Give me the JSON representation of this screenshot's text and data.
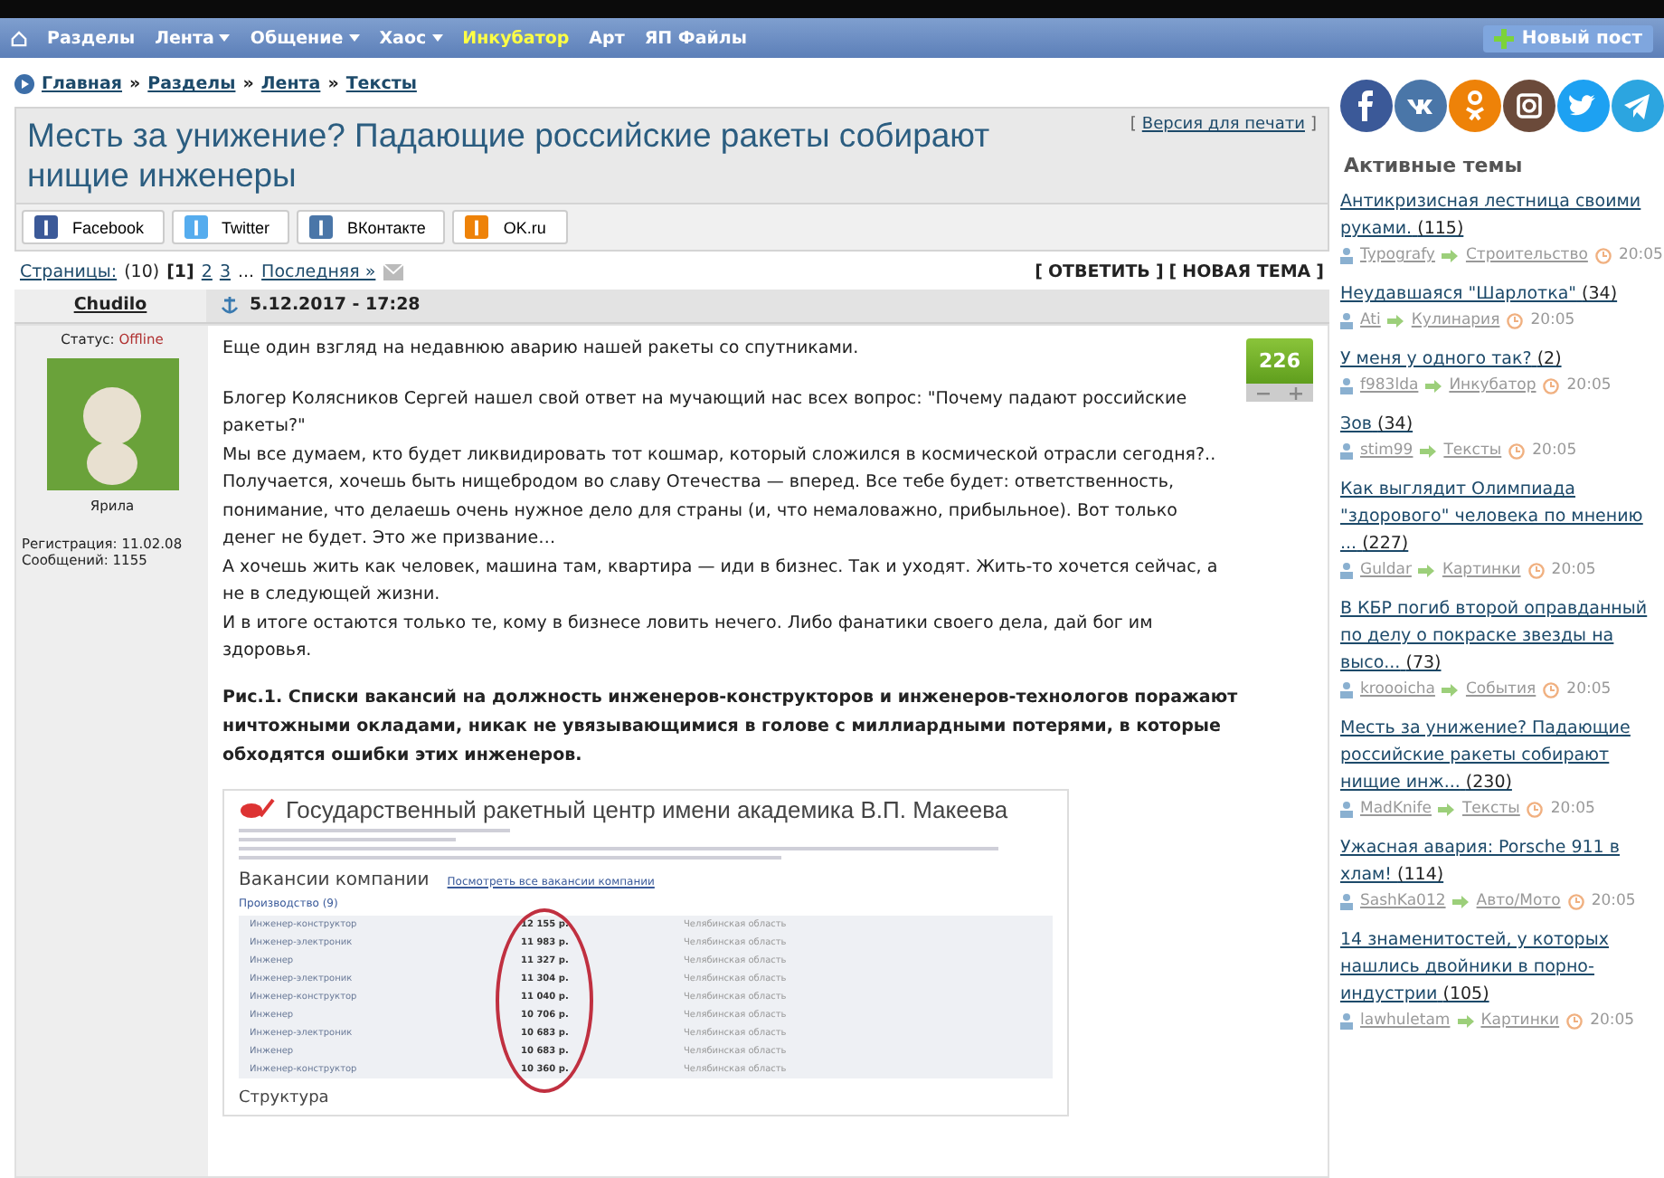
{
  "nav": {
    "items": [
      {
        "label": "Разделы",
        "dropdown": false,
        "selected": false
      },
      {
        "label": "Лента",
        "dropdown": true,
        "selected": false
      },
      {
        "label": "Общение",
        "dropdown": true,
        "selected": false
      },
      {
        "label": "Хаос",
        "dropdown": true,
        "selected": false
      },
      {
        "label": "Инкубатор",
        "dropdown": false,
        "selected": true
      },
      {
        "label": "Арт",
        "dropdown": false,
        "selected": false
      },
      {
        "label": "ЯП Файлы",
        "dropdown": false,
        "selected": false
      }
    ],
    "new_post": "Новый пост"
  },
  "breadcrumbs": [
    {
      "label": "Главная"
    },
    {
      "separator": "»",
      "label": "Разделы"
    },
    {
      "separator": "»",
      "label": "Лента"
    },
    {
      "separator": "»",
      "label": "Тексты"
    }
  ],
  "topic": {
    "title": "Месть за унижение? Падающие российские ракеты собирают нищие инженеры",
    "print_link": {
      "open": "[",
      "label": "Версия для печати",
      "close": "]"
    }
  },
  "share": [
    {
      "kind": "facebook",
      "label": "Facebook"
    },
    {
      "kind": "twitter",
      "label": "Twitter"
    },
    {
      "kind": "vk",
      "label": "ВКонтакте"
    },
    {
      "kind": "ok",
      "label": "OK.ru"
    }
  ],
  "pager": {
    "label": "Страницы:",
    "count": "(10)",
    "pages": [
      {
        "label": "[1]",
        "selected": true
      },
      {
        "label": "2",
        "selected": false
      },
      {
        "label": "3",
        "selected": false
      }
    ],
    "ellipsis": "...",
    "last": "Последняя »"
  },
  "actions": [
    {
      "open": "[",
      "label": "ОТВЕТИТЬ",
      "close": "]"
    },
    {
      "open": "[",
      "label": "НОВАЯ ТЕМА",
      "close": "]"
    }
  ],
  "post": {
    "author": "Chudilo",
    "date": "5.12.2017 - 17:28",
    "status_label": "Статус:",
    "status": "Offline",
    "online": false,
    "rank": "Ярила",
    "registered": "Регистрация: 11.02.08",
    "messages": "Сообщений: 1155",
    "rating": "226",
    "paragraphs": [
      "Еще один взгляд на недавнюю аварию нашей ракеты со спутниками.",
      "Блогер Колясников Сергей нашел свой ответ на мучающий нас всех вопрос: \"Почему падают российские ракеты?\"",
      "Мы все думаем, кто будет ликвидировать тот кошмар, который сложился в космической отрасли сегодня?..",
      "Получается, хочешь быть нищебродом во славу Отечества — вперед. Все тебе будет: ответственность, понимание, что делаешь очень нужное дело для страны (и, что немаловажно, прибыльное). Вот только денег не будет. Это же призвание…",
      "А хочешь жить как человек, машина там, квартира — иди в бизнес. Так и уходят. Жить-то хочется сейчас, а не в следующей жизни.",
      "И в итоге остаются только те, кому в бизнесе ловить нечего. Либо фанатики своего дела, дай бог им здоровья."
    ],
    "caption": "Рис.1. Списки вакансий на должность инженеров-конструкторов и инженеров-технологов поражают ничтожными окладами, никак не увязывающимися в голове с миллиардными потерями, в которые обходятся ошибки этих инженеров.",
    "screenshot": {
      "org": "Государственный ракетный центр имени академика В.П. Макеева",
      "vacancies": "Вакансии компании",
      "all_link": "Посмотреть все вакансии компании",
      "group": "Производство (9)",
      "rows": [
        {
          "job": "Инженер-конструктор",
          "salary": "12 155 р.",
          "region": "Челябинская область"
        },
        {
          "job": "Инженер-электроник",
          "salary": "11 983 р.",
          "region": "Челябинская область"
        },
        {
          "job": "Инженер",
          "salary": "11 327 р.",
          "region": "Челябинская область"
        },
        {
          "job": "Инженер-электроник",
          "salary": "11 304 р.",
          "region": "Челябинская область"
        },
        {
          "job": "Инженер-конструктор",
          "salary": "11 040 р.",
          "region": "Челябинская область"
        },
        {
          "job": "Инженер",
          "salary": "10 706 р.",
          "region": "Челябинская область"
        },
        {
          "job": "Инженер-электроник",
          "salary": "10 683 р.",
          "region": "Челябинская область"
        },
        {
          "job": "Инженер",
          "salary": "10 683 р.",
          "region": "Челябинская область"
        },
        {
          "job": "Инженер-конструктор",
          "salary": "10 360 р.",
          "region": "Челябинская область"
        }
      ],
      "structure": "Структура"
    }
  },
  "sidebar": {
    "socials": [
      {
        "kind": "facebook",
        "color": "#3b5998"
      },
      {
        "kind": "vk",
        "color": "#4a76a8"
      },
      {
        "kind": "ok",
        "color": "#ee8208"
      },
      {
        "kind": "instagram",
        "color": "#6b4a3a"
      },
      {
        "kind": "twitter",
        "color": "#1da1f2"
      },
      {
        "kind": "telegram",
        "color": "#2ca5e0"
      }
    ],
    "heading": "Активные темы",
    "topics": [
      {
        "title": "Антикризисная лестница своими руками.",
        "count": "(115)",
        "user": "Typografy",
        "section": "Строительство",
        "time": "20:05"
      },
      {
        "title": "Неудавшаяся \"Шарлотка\"",
        "count": "(34)",
        "user": "Ati",
        "section": "Кулинария",
        "time": "20:05"
      },
      {
        "title": "У меня у одного так?",
        "count": "(2)",
        "user": "f983lda",
        "section": "Инкубатор",
        "time": "20:05"
      },
      {
        "title": "Зов",
        "count": "(34)",
        "user": "stim99",
        "section": "Тексты",
        "time": "20:05"
      },
      {
        "title": "Как выглядит Олимпиада \"здорового\" человека по мнению ...",
        "count": "(227)",
        "user": "Guldar",
        "section": "Картинки",
        "time": "20:05"
      },
      {
        "title": "В КБР погиб второй оправданный по делу о покраске звезды на высо...",
        "count": "(73)",
        "user": "kroooicha",
        "section": "События",
        "time": "20:05"
      },
      {
        "title": "Месть за унижение? Падающие российские ракеты собирают нищие инж...",
        "count": "(230)",
        "user": "MadKnife",
        "section": "Тексты",
        "time": "20:05"
      },
      {
        "title": "Ужасная авария: Porsche 911 в хлам!",
        "count": "(114)",
        "user": "SashKa012",
        "section": "Авто/Мото",
        "time": "20:05"
      },
      {
        "title": "14 знаменитостей, у которых нашлись двойники в порно-индустрии",
        "count": "(105)",
        "user": "lawhuletam",
        "section": "Картинки",
        "time": "20:05"
      }
    ]
  }
}
